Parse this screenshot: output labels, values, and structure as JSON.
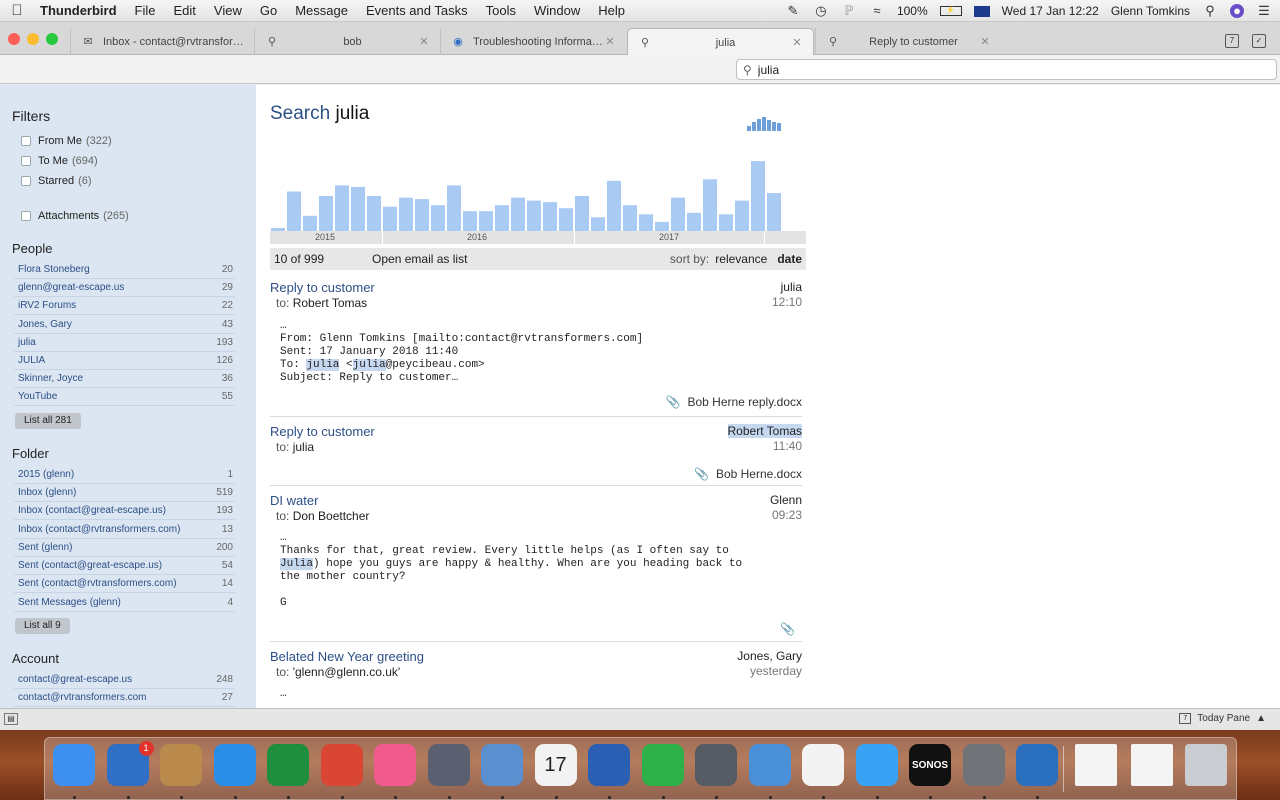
{
  "menubar": {
    "app": "Thunderbird",
    "items": [
      "File",
      "Edit",
      "View",
      "Go",
      "Message",
      "Events and Tasks",
      "Tools",
      "Window",
      "Help"
    ],
    "battery": "100%",
    "datetime": "Wed 17 Jan  12:22",
    "user": "Glenn Tomkins"
  },
  "tabs": [
    {
      "label": "Inbox - contact@rvtransformer...",
      "icon": "mail-icon"
    },
    {
      "label": "bob",
      "icon": "search-icon"
    },
    {
      "label": "Troubleshooting Information",
      "icon": "thunderbird-icon"
    },
    {
      "label": "julia",
      "icon": "search-icon"
    },
    {
      "label": "Reply to customer",
      "icon": "search-icon"
    }
  ],
  "search": {
    "value": "julia"
  },
  "sidebar": {
    "filters_title": "Filters",
    "filters": [
      {
        "label": "From Me",
        "count": "(322)"
      },
      {
        "label": "To Me",
        "count": "(694)"
      },
      {
        "label": "Starred",
        "count": "(6)"
      },
      {
        "label": "Attachments",
        "count": "(265)"
      }
    ],
    "people_title": "People",
    "people": [
      {
        "name": "Flora Stoneberg",
        "count": "20"
      },
      {
        "name": "glenn@great-escape.us",
        "count": "29"
      },
      {
        "name": "iRV2 Forums",
        "count": "22"
      },
      {
        "name": "Jones, Gary",
        "count": "43"
      },
      {
        "name": "julia",
        "count": "193"
      },
      {
        "name": "JULIA",
        "count": "126"
      },
      {
        "name": "Skinner, Joyce",
        "count": "36"
      },
      {
        "name": "YouTube",
        "count": "55"
      }
    ],
    "people_listall": "List all 281",
    "folder_title": "Folder",
    "folders": [
      {
        "name": "2015 (glenn)",
        "count": "1"
      },
      {
        "name": "Inbox (glenn)",
        "count": "519"
      },
      {
        "name": "Inbox (contact@great-escape.us)",
        "count": "193"
      },
      {
        "name": "Inbox (contact@rvtransformers.com)",
        "count": "13"
      },
      {
        "name": "Sent (glenn)",
        "count": "200"
      },
      {
        "name": "Sent (contact@great-escape.us)",
        "count": "54"
      },
      {
        "name": "Sent (contact@rvtransformers.com)",
        "count": "14"
      },
      {
        "name": "Sent Messages (glenn)",
        "count": "4"
      }
    ],
    "folder_listall": "List all 9",
    "account_title": "Account",
    "accounts": [
      {
        "name": "contact@great-escape.us",
        "count": "248"
      },
      {
        "name": "contact@rvtransformers.com",
        "count": "27"
      }
    ]
  },
  "main": {
    "title_prefix": "Search",
    "title_query": "julia",
    "results_count": "10 of 999",
    "open_as_list": "Open email as list",
    "sort_by": "sort by:",
    "sort_relevance": "relevance",
    "sort_date": "date"
  },
  "chart_data": {
    "type": "bar",
    "x_labels": [
      "2015",
      "2016",
      "2017"
    ],
    "values": [
      2,
      26,
      10,
      23,
      30,
      29,
      23,
      16,
      22,
      21,
      17,
      30,
      13,
      13,
      17,
      22,
      20,
      19,
      15,
      23,
      9,
      33,
      17,
      11,
      6,
      22,
      12,
      34,
      11,
      20,
      46,
      25
    ],
    "color": "#a9cbf3",
    "title": "",
    "xlabel": "",
    "ylabel": ""
  },
  "messages": [
    {
      "subject": "Reply to customer",
      "to_label": "to:",
      "to": "Robert Tomas",
      "from": "julia",
      "time": "12:10",
      "body_lines": [
        "…",
        "From: Glenn Tomkins [mailto:contact@rvtransformers.com]",
        "Sent: 17 January 2018 11:40",
        "To: ",
        "julia",
        " <",
        "julia",
        "@peycibeau.com>",
        "Subject: Reply to customer…"
      ],
      "attachment": "Bob Herne reply.docx"
    },
    {
      "subject": "Reply to customer",
      "to_label": "to:",
      "to": "julia",
      "from": "Robert Tomas",
      "time": "11:40",
      "attachment": "Bob Herne.docx"
    },
    {
      "subject": "DI water",
      "to_label": "to:",
      "to": "Don Boettcher",
      "from": "Glenn",
      "time": "09:23",
      "body_lines": [
        "…",
        "Thanks for that, great review. Every little helps (as I often say to",
        "Julia",
        ") hope you guys are happy & healthy. When are you heading back to",
        "the mother country?",
        "G"
      ]
    },
    {
      "subject": "Belated New Year greeting",
      "to_label": "to:",
      "to": "'glenn@glenn.co.uk'",
      "from": "Jones, Gary",
      "time": "yesterday",
      "body_lines": [
        "…"
      ]
    }
  ],
  "statusbar": {
    "today_pane": "Today Pane"
  },
  "dock": [
    {
      "name": "finder",
      "color": "#3d8ff0"
    },
    {
      "name": "thunderbird",
      "color": "#2f6fc6",
      "badge": "1"
    },
    {
      "name": "contacts",
      "color": "#b98a4c"
    },
    {
      "name": "safari",
      "color": "#2a8de8"
    },
    {
      "name": "excel",
      "color": "#1f8f3f"
    },
    {
      "name": "chrome",
      "color": "#d94633"
    },
    {
      "name": "itunes",
      "color": "#f05a8c"
    },
    {
      "name": "launchpad",
      "color": "#5a6070"
    },
    {
      "name": "preview",
      "color": "#5a8fd0"
    },
    {
      "name": "calendar",
      "color": "#f2f2f2",
      "label": "17",
      "month": "JAN"
    },
    {
      "name": "word",
      "color": "#2b5fb3"
    },
    {
      "name": "evernote",
      "color": "#2fb14a"
    },
    {
      "name": "sequel-pro",
      "color": "#555b63"
    },
    {
      "name": "skype-business",
      "color": "#4a90d9"
    },
    {
      "name": "photos",
      "color": "#f3f3f3"
    },
    {
      "name": "messages",
      "color": "#38a3f5"
    },
    {
      "name": "sonos",
      "color": "#111111",
      "label": "SONOS"
    },
    {
      "name": "system-preferences",
      "color": "#6f7277"
    },
    {
      "name": "wunderlist",
      "color": "#2a6fbd"
    }
  ]
}
